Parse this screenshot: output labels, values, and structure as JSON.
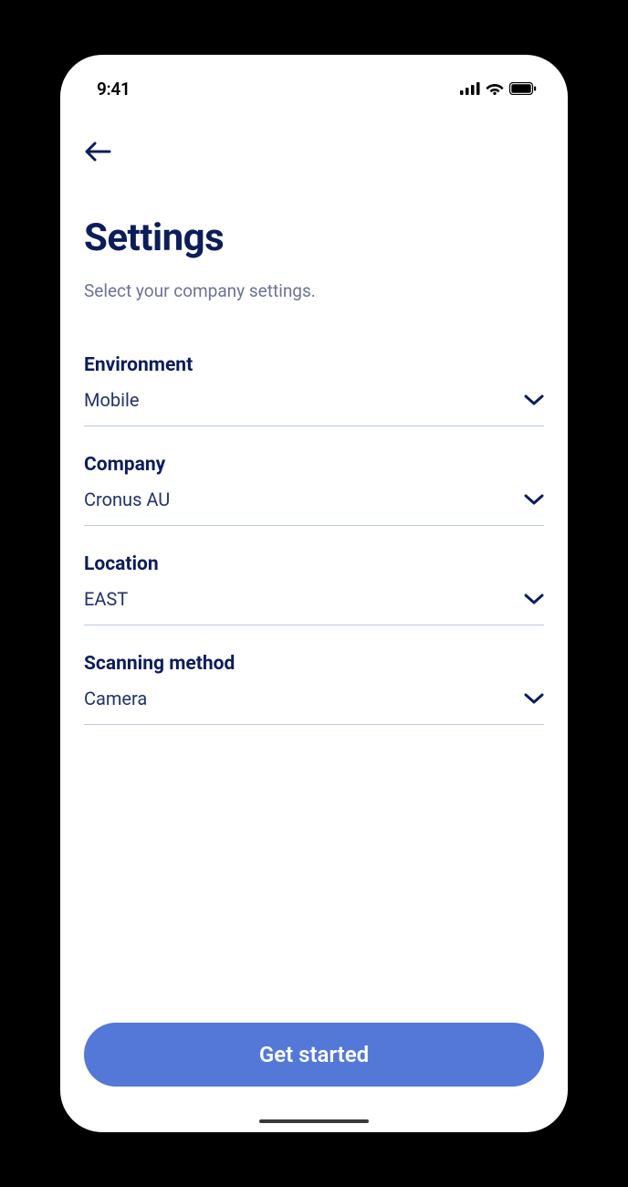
{
  "status_bar": {
    "time": "9:41"
  },
  "header": {
    "title": "Settings",
    "subtitle": "Select your company settings."
  },
  "fields": [
    {
      "label": "Environment",
      "value": "Mobile"
    },
    {
      "label": "Company",
      "value": "Cronus AU"
    },
    {
      "label": "Location",
      "value": "EAST"
    },
    {
      "label": "Scanning method",
      "value": "Camera"
    }
  ],
  "footer": {
    "primary_button": "Get started"
  },
  "colors": {
    "heading": "#0c1d5a",
    "subtitle": "#6b7398",
    "value": "#243269",
    "divider": "#bcc7e6",
    "primary": "#5378d7"
  }
}
